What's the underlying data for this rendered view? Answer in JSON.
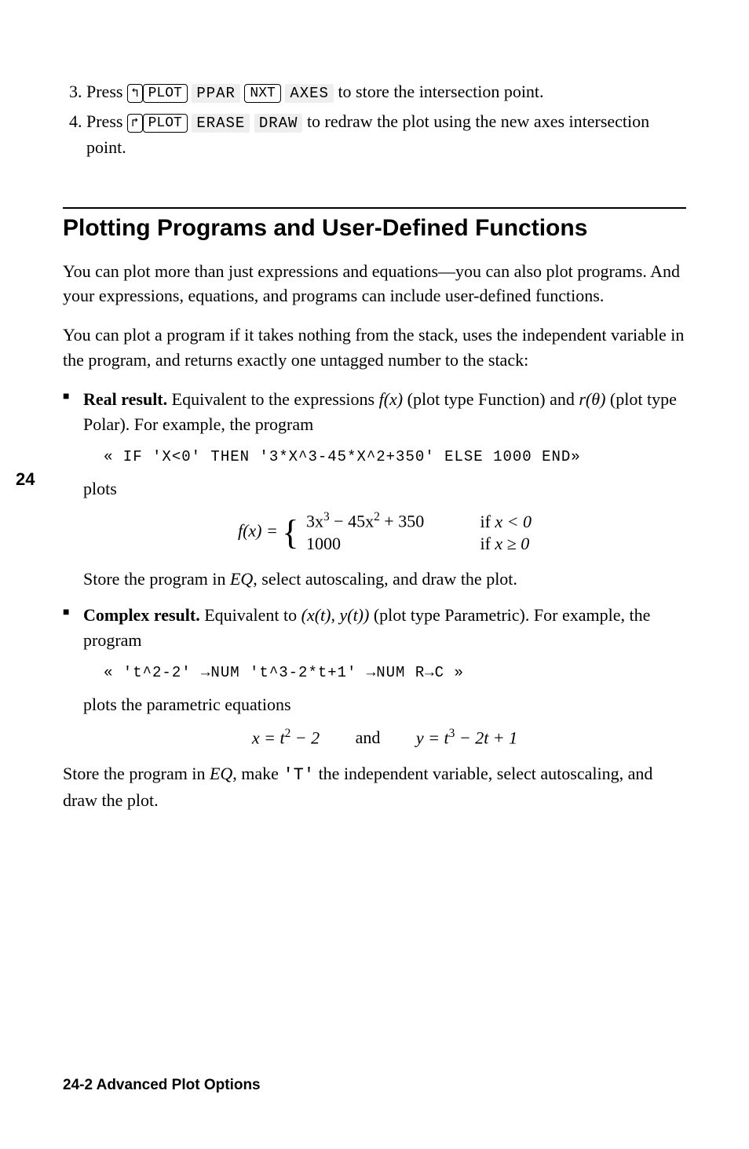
{
  "sideTab": "24",
  "steps": {
    "s3": {
      "num": "3.",
      "t1": "Press ",
      "k1": "↰",
      "k2": "PLOT",
      "soft1": "PPAR",
      "k3": "NXT",
      "soft2": "AXES",
      "t2": " to store the intersection point."
    },
    "s4": {
      "num": "4.",
      "t1": "Press ",
      "k1": "↱",
      "k2": "PLOT",
      "soft1": "ERASE",
      "soft2": "DRAW",
      "t2": " to redraw the plot using the new axes intersection point."
    }
  },
  "heading": "Plotting Programs and User-Defined Functions",
  "para1": "You can plot more than just expressions and equations—you can also plot programs. And your expressions, equations, and programs can include user-defined functions.",
  "para2": "You can plot a program if it takes nothing from the stack, uses the independent variable in the program, and returns exactly one untagged number to the stack:",
  "bullet1": {
    "lead": "Real result.",
    "txt1": " Equivalent to the expressions ",
    "fx": "f(x)",
    "txt2": " (plot type Function) and ",
    "rth": "r(θ)",
    "txt3": " (plot type Polar). For example, the program",
    "code": "« IF 'X<0' THEN '3*X^3-45*X^2+350' ELSE 1000 END»",
    "plots": "plots",
    "store": "Store the program in ",
    "EQ": "EQ",
    "storeEnd": ", select autoscaling, and draw the plot."
  },
  "eq1": {
    "lhs": "f(x) = ",
    "c1a": "3x",
    "c1aSup": "3",
    "c1b": " − 45x",
    "c1bSup": "2",
    "c1c": " + 350",
    "cond1a": "if ",
    "cond1b": "x < 0",
    "c2": "1000",
    "cond2a": "if ",
    "cond2b": "x ≥ 0"
  },
  "bullet2": {
    "lead": "Complex result.",
    "txt1": " Equivalent to ",
    "xy": "(x(t), y(t))",
    "txt2": " (plot type Parametric). For example, the program",
    "code": "« 't^2-2' →NUM 't^3-2*t+1' →NUM R→C »",
    "plots": "plots the parametric equations"
  },
  "eq2": {
    "x1": "x = t",
    "x1Sup": "2",
    "x2": " − 2",
    "and": "and",
    "y1": "y = t",
    "y1Sup": "3",
    "y2": " − 2t + 1"
  },
  "finalPara": {
    "t1": "Store the program in ",
    "EQ": "EQ",
    "t2": ", make ",
    "T": "'T'",
    "t3": " the independent variable, select autoscaling, and draw the plot."
  },
  "footer": "24-2  Advanced Plot Options"
}
